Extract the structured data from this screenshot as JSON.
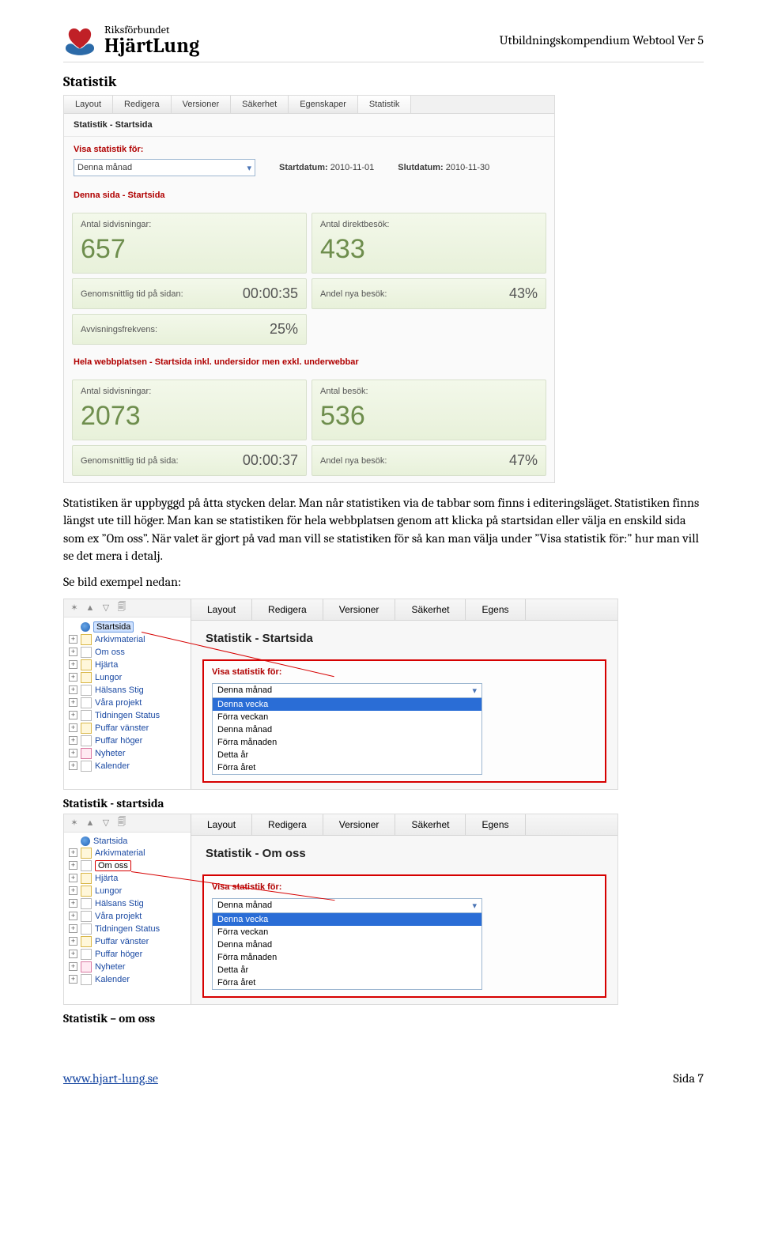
{
  "logo": {
    "top": "Riksförbundet",
    "bot": "HjärtLung"
  },
  "doc_header": "Utbildningskompendium Webtool Ver 5",
  "heading": "Statistik",
  "fig1": {
    "tabs": [
      "Layout",
      "Redigera",
      "Versioner",
      "Säkerhet",
      "Egenskaper",
      "Statistik"
    ],
    "subhead": "Statistik - Startsida",
    "filter_label": "Visa statistik för:",
    "filter_value": "Denna månad",
    "start_label": "Startdatum:",
    "start_value": "2010-11-01",
    "end_label": "Slutdatum:",
    "end_value": "2010-11-30",
    "section1": "Denna sida - Startsida",
    "stats1": {
      "c0": {
        "lbl": "Antal sidvisningar:",
        "val": "657"
      },
      "c1": {
        "lbl": "Antal direktbesök:",
        "val": "433"
      },
      "c2": {
        "lbl": "Genomsnittlig tid på sidan:",
        "val": "00:00:35"
      },
      "c3": {
        "lbl": "Andel nya besök:",
        "val": "43%"
      },
      "c4": {
        "lbl": "Avvisningsfrekvens:",
        "val": "25%"
      }
    },
    "section2": "Hela webbplatsen - Startsida inkl. undersidor men exkl. underwebbar",
    "stats2": {
      "c0": {
        "lbl": "Antal sidvisningar:",
        "val": "2073"
      },
      "c1": {
        "lbl": "Antal besök:",
        "val": "536"
      },
      "c2": {
        "lbl": "Genomsnittlig tid på sida:",
        "val": "00:00:37"
      },
      "c3": {
        "lbl": "Andel nya besök:",
        "val": "47%"
      }
    }
  },
  "para": "Statistiken är uppbyggd på åtta stycken delar. Man når statistiken via de tabbar som finns i editeringsläget. Statistiken finns längst ute till höger. Man kan se statistiken för hela webbplatsen genom att klicka på startsidan eller välja en enskild sida som ex ”Om oss”. När valet är gjort på vad man vill se statistiken för så kan man välja under ”Visa statistik för:” hur man vill se det mera i detalj.",
  "se_bild": "Se bild exempel nedan:",
  "tabs2": [
    "Layout",
    "Redigera",
    "Versioner",
    "Säkerhet",
    "Egens"
  ],
  "tree_items": [
    {
      "k": "globe",
      "t": "Startsida",
      "sel": true
    },
    {
      "k": "warn",
      "t": "Arkivmaterial"
    },
    {
      "k": "page",
      "t": "Om oss"
    },
    {
      "k": "warn",
      "t": "Hjärta"
    },
    {
      "k": "warn",
      "t": "Lungor"
    },
    {
      "k": "page",
      "t": "Hälsans Stig"
    },
    {
      "k": "page",
      "t": "Våra projekt"
    },
    {
      "k": "page",
      "t": "Tidningen Status"
    },
    {
      "k": "warn",
      "t": "Puffar vänster"
    },
    {
      "k": "page",
      "t": "Puffar höger"
    },
    {
      "k": "news",
      "t": "Nyheter"
    },
    {
      "k": "page",
      "t": "Kalender"
    }
  ],
  "fig2": {
    "head": "Statistik - Startsida",
    "dd_top": "Denna månad",
    "dd_items": [
      "Denna vecka",
      "Förra veckan",
      "Denna månad",
      "Förra månaden",
      "Detta år",
      "Förra året"
    ]
  },
  "caption2": "Statistik - startsida",
  "tree3_items": [
    {
      "k": "globe",
      "t": "Startsida"
    },
    {
      "k": "warn",
      "t": "Arkivmaterial"
    },
    {
      "k": "page",
      "t": "Om oss",
      "sel": true
    },
    {
      "k": "warn",
      "t": "Hjärta"
    },
    {
      "k": "warn",
      "t": "Lungor"
    },
    {
      "k": "page",
      "t": "Hälsans Stig"
    },
    {
      "k": "page",
      "t": "Våra projekt"
    },
    {
      "k": "page",
      "t": "Tidningen Status"
    },
    {
      "k": "warn",
      "t": "Puffar vänster"
    },
    {
      "k": "page",
      "t": "Puffar höger"
    },
    {
      "k": "news",
      "t": "Nyheter"
    },
    {
      "k": "page",
      "t": "Kalender"
    }
  ],
  "fig3": {
    "head": "Statistik - Om oss",
    "dd_top": "Denna månad",
    "dd_items": [
      "Denna vecka",
      "Förra veckan",
      "Denna månad",
      "Förra månaden",
      "Detta år",
      "Förra året"
    ]
  },
  "caption3": "Statistik – om oss",
  "footer": {
    "url_text": "www.hjart-lung.se",
    "pagelabel": "Sida 7"
  }
}
